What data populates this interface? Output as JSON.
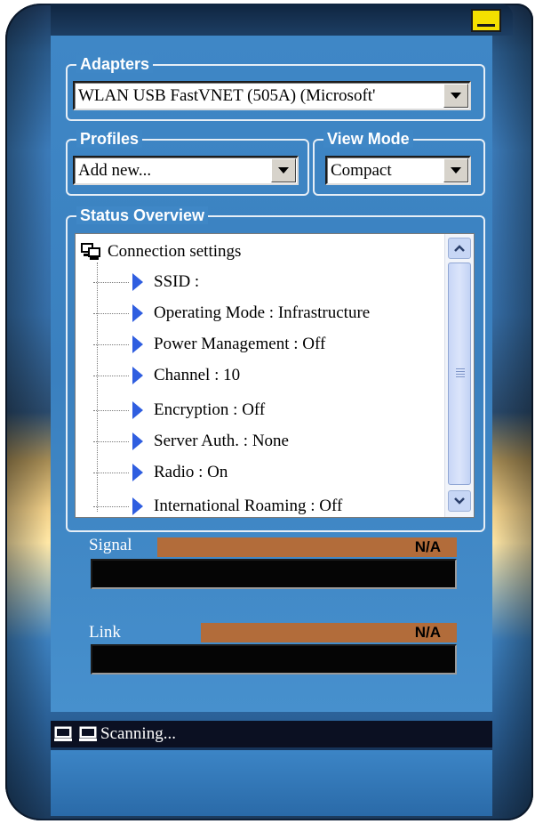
{
  "window": {
    "minimize_icon": "minimize-icon"
  },
  "adapters": {
    "legend": "Adapters",
    "selected": "WLAN USB FastVNET (505A) (Microsoft'"
  },
  "profiles": {
    "legend": "Profiles",
    "selected": "Add new..."
  },
  "view_mode": {
    "legend": "View Mode",
    "selected": "Compact"
  },
  "status_overview": {
    "legend": "Status Overview",
    "root_label": "Connection settings",
    "items": [
      "SSID :",
      "Operating Mode : Infrastructure",
      "Power Management : Off",
      "Channel : 10",
      "Encryption : Off",
      "Server Auth. : None",
      "Radio : On",
      "International Roaming : Off"
    ]
  },
  "signal": {
    "label": "Signal",
    "value": "N/A"
  },
  "link": {
    "label": "Link",
    "value": "N/A"
  },
  "statusbar": {
    "text": "Scanning..."
  },
  "colors": {
    "panel": "#3f87c6",
    "meter_strip": "#b26c3a",
    "tree_pointer": "#2f5ee0",
    "minimize_button": "#f4e000"
  }
}
